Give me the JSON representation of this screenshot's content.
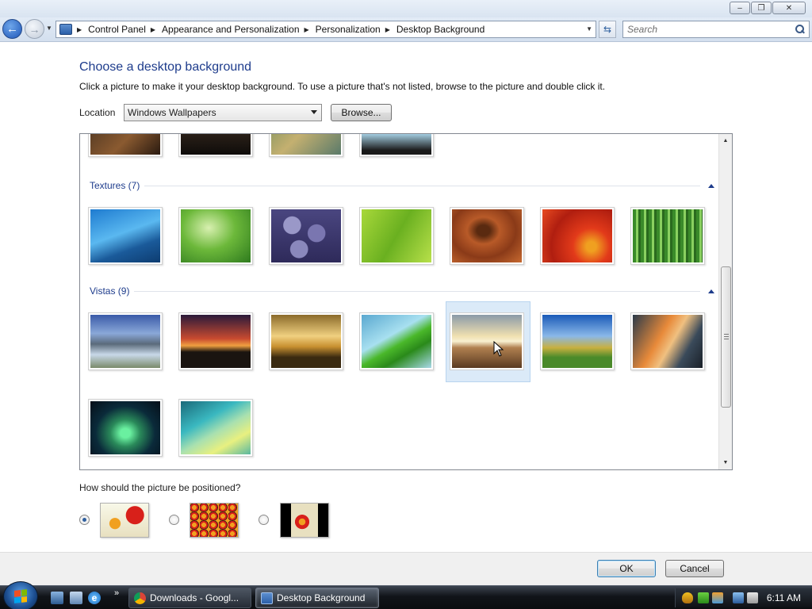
{
  "window": {
    "controls": {
      "minimize": "‒",
      "maximize": "❐",
      "close": "✕"
    }
  },
  "address_bar": {
    "crumbs": [
      "Control Panel",
      "Appearance and Personalization",
      "Personalization",
      "Desktop Background"
    ],
    "search_placeholder": "Search"
  },
  "page": {
    "title": "Choose a desktop background",
    "description": "Click a picture to make it your desktop background. To use a picture that's not listed, browse to the picture and double click it.",
    "location_label": "Location",
    "location_value": "Windows Wallpapers",
    "browse_label": "Browse..."
  },
  "gallery": {
    "groups": [
      {
        "title": "Textures (7)",
        "count": 7
      },
      {
        "title": "Vistas (9)",
        "count": 9
      }
    ],
    "selected": "Vistas item 5"
  },
  "positioning": {
    "label": "How should the picture be positioned?",
    "options": [
      "fit-to-screen",
      "tile",
      "center"
    ],
    "selected": "fit-to-screen"
  },
  "footer": {
    "ok_label": "OK",
    "cancel_label": "Cancel"
  },
  "taskbar": {
    "more": "»",
    "items": [
      {
        "label": "Downloads - Googl...",
        "active": false
      },
      {
        "label": "Desktop Background",
        "active": true
      }
    ],
    "clock": "6:11 AM"
  }
}
